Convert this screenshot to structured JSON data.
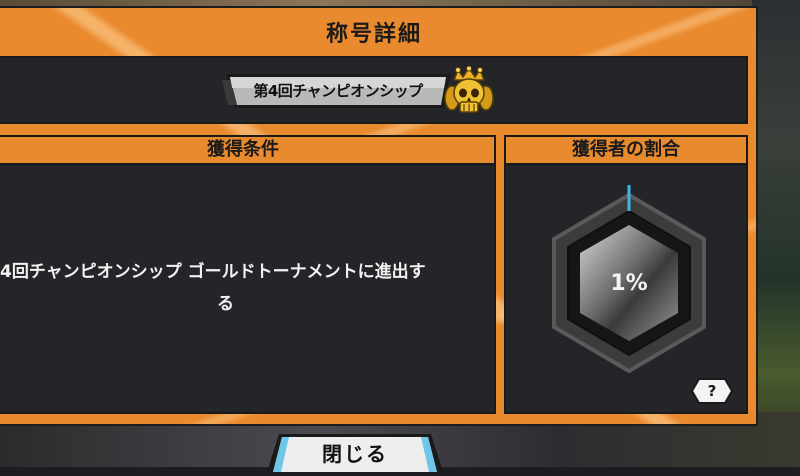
{
  "dialog": {
    "title": "称号詳細"
  },
  "badge": {
    "name": "第4回チャンピオンシップ",
    "icon": "gold-skull-crown-icon"
  },
  "condition": {
    "header": "獲得条件",
    "text_line1": "4回チャンピオンシップ ゴールドトーナメントに進出す",
    "text_line2": "る"
  },
  "ratio": {
    "header": "獲得者の割合",
    "value_text": "1%",
    "value": 1
  },
  "help_button": {
    "label": "?"
  },
  "close_button": {
    "label": "閉じる"
  },
  "colors": {
    "frame_orange": "#e98a2f",
    "panel_dark": "#232528",
    "gauge_accent": "#3fb6e6",
    "badge_gold": "#e8b426"
  }
}
